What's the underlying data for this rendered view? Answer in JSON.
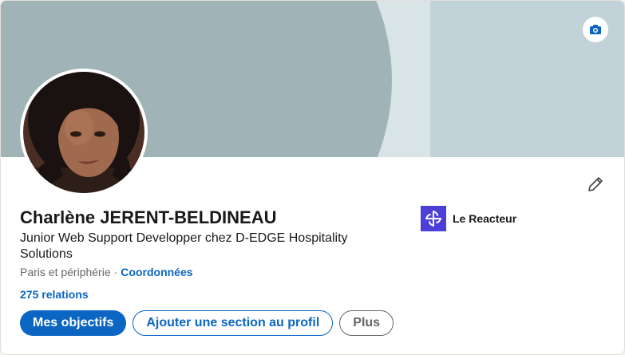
{
  "profile": {
    "name": "Charlène JERENT-BELDINEAU",
    "headline": "Junior Web Support Developper chez D-EDGE Hospitality Solutions",
    "location": "Paris et périphérie",
    "separator": "·",
    "contact_link": "Coordonnées",
    "relations": "275 relations"
  },
  "buttons": {
    "primary": "Mes objectifs",
    "add_section": "Ajouter une section au profil",
    "more": "Plus"
  },
  "company": {
    "name": "Le Reacteur"
  },
  "icons": {
    "banner_camera": "camera-icon",
    "edit": "pencil-icon",
    "company_logo": "le-reacteur-logo"
  },
  "colors": {
    "accent": "#0a66c2",
    "banner": "#c1d3d8",
    "logo": "#4b3fd8"
  }
}
